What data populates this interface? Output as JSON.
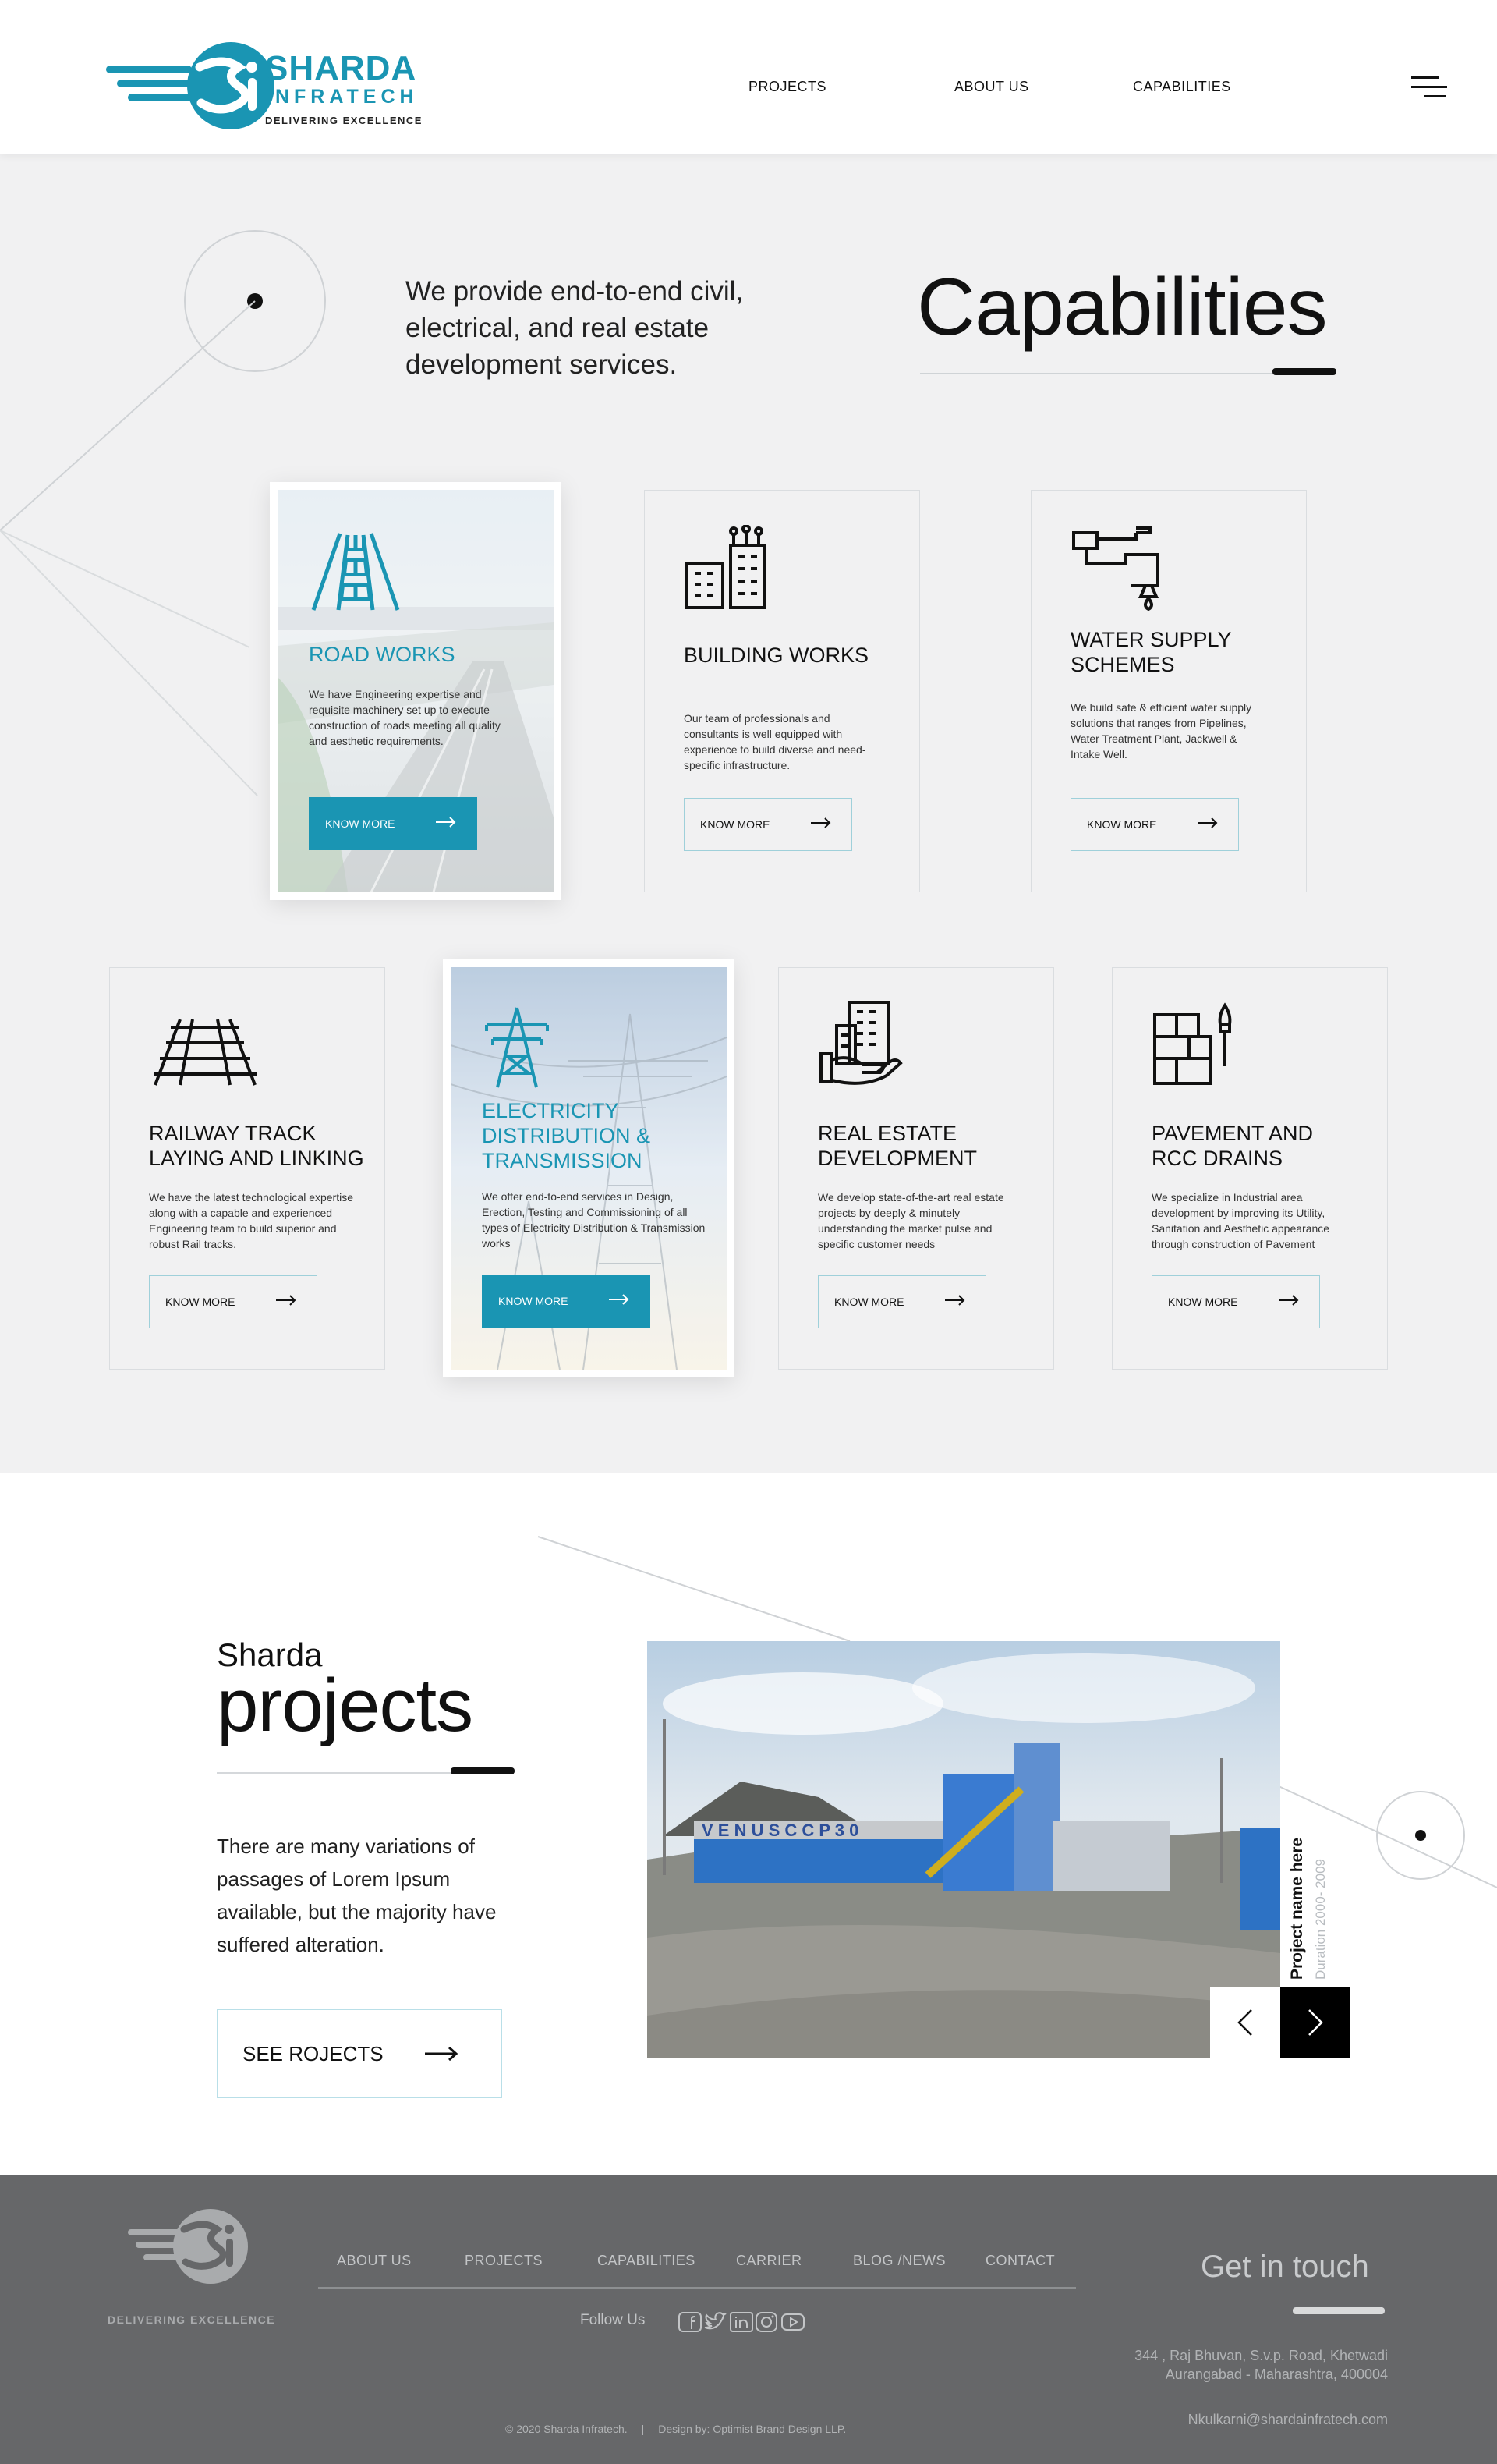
{
  "header": {
    "logo_name": "SHARDA",
    "logo_sub": "INFRATECH",
    "logo_tagline": "DELIVERING EXCELLENCE",
    "nav": [
      "PROJECTS",
      "ABOUT US",
      "CAPABILITIES"
    ]
  },
  "capabilities": {
    "intro": "We provide end-to-end civil, electrical, and real estate development services.",
    "title": "Capabilities",
    "cards": [
      {
        "title": "ROAD WORKS",
        "desc": "We have Engineering expertise and requisite machinery set up to execute construction of roads meeting all quality and aesthetic requirements.",
        "button": "KNOW MORE",
        "icon": "road-icon",
        "featured": true
      },
      {
        "title": "BUILDING WORKS",
        "desc": "Our team of professionals and consultants is well equipped with experience to build diverse and need-specific infrastructure.",
        "button": "KNOW MORE",
        "icon": "building-icon"
      },
      {
        "title": "WATER SUPPLY SCHEMES",
        "desc": "We build safe & efficient water supply solutions that ranges from Pipelines, Water Treatment Plant, Jackwell & Intake Well.",
        "button": "KNOW MORE",
        "icon": "water-tap-icon"
      },
      {
        "title": "RAILWAY TRACK LAYING AND LINKING",
        "desc": "We have the latest technological expertise along with a capable and experienced Engineering team to build superior and robust Rail tracks.",
        "button": "KNOW MORE",
        "icon": "railway-track-icon"
      },
      {
        "title": "ELECTRICITY DISTRIBUTION & TRANSMISSION",
        "desc": "We offer end-to-end services in Design, Erection, Testing and Commissioning of all types of Electricity Distribution & Transmission works",
        "button": "KNOW MORE",
        "icon": "power-tower-icon",
        "featured": true
      },
      {
        "title": "REAL ESTATE DEVELOPMENT",
        "desc": "We develop state-of-the-art real estate projects by deeply & minutely understanding the market pulse and specific customer needs",
        "button": "KNOW MORE",
        "icon": "real-estate-icon"
      },
      {
        "title": "PAVEMENT AND RCC DRAINS",
        "desc": "We specialize in Industrial area development by improving its Utility, Sanitation and Aesthetic appearance through construction of Pavement",
        "button": "KNOW MORE",
        "icon": "pavement-icon"
      }
    ]
  },
  "projects": {
    "small": "Sharda",
    "big": "projects",
    "desc": "There are many variations of passages of Lorem Ipsum available, but the majority have suffered alteration.",
    "button": "SEE ROJECTS",
    "photo_text": "V E N U S   C C P 3 0",
    "project_name": "Project name here",
    "project_duration": "Duration 2000- 2009"
  },
  "footer": {
    "tagline": "DELIVERING EXCELLENCE",
    "nav": [
      "ABOUT US",
      "PROJECTS",
      "CAPABILITIES",
      "CARRIER",
      "BLOG /NEWS",
      "CONTACT"
    ],
    "follow": "Follow Us",
    "social": [
      "facebook-icon",
      "twitter-icon",
      "linkedin-icon",
      "instagram-icon",
      "youtube-icon"
    ],
    "get_in_touch": "Get in touch",
    "address_line1": "344 , Raj Bhuvan, S.v.p. Road, Khetwadi",
    "address_line2": "Aurangabad -  Maharashtra, 400004",
    "email": "Nkulkarni@shardainfratech.com",
    "copyright": "© 2020 Sharda Infratech.",
    "separator": "|",
    "design_by": "Design by: Optimist Brand Design LLP."
  },
  "colors": {
    "accent": "#1a95b3",
    "footer": "#666769",
    "background": "#f1f1f2"
  }
}
